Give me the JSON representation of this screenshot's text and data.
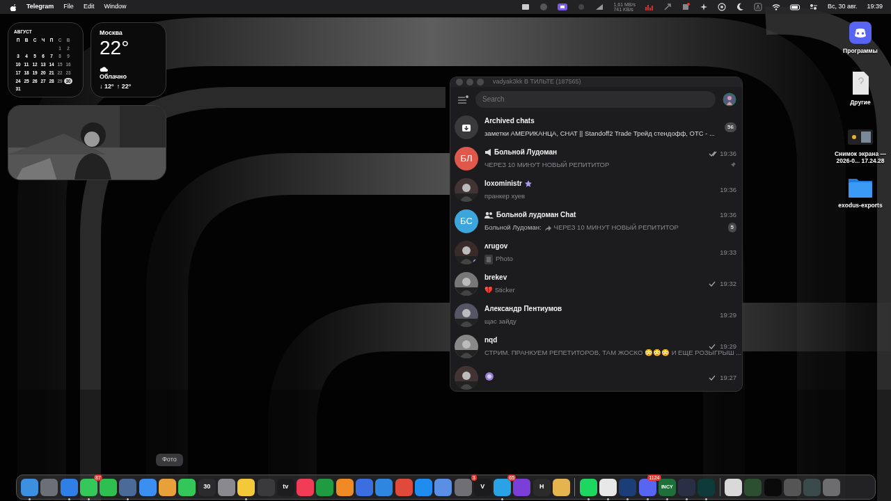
{
  "menu_bar": {
    "app": "Telegram",
    "menus": [
      "File",
      "Edit",
      "Window"
    ],
    "net_up": "1,61 MB/s",
    "net_down": "741 KB/s",
    "date": "Вс, 30 авг.",
    "time": "19:39"
  },
  "calendar_widget": {
    "month": "АВГУСТ",
    "weekdays": [
      "П",
      "В",
      "С",
      "Ч",
      "П",
      "С",
      "В"
    ],
    "weeks": [
      [
        {
          "day": "1",
          "selected": false
        },
        {
          "day": "2",
          "selected": false
        }
      ],
      [
        {
          "day": "3",
          "selected": false
        },
        {
          "day": "4",
          "selected": false
        },
        {
          "day": "5",
          "selected": false
        },
        {
          "day": "6",
          "selected": false
        },
        {
          "day": "7",
          "selected": false
        },
        {
          "day": "8",
          "selected": false
        },
        {
          "day": "9",
          "selected": false
        }
      ],
      [
        {
          "day": "10",
          "selected": false
        },
        {
          "day": "11",
          "selected": false
        },
        {
          "day": "12",
          "selected": false
        },
        {
          "day": "13",
          "selected": false
        },
        {
          "day": "14",
          "selected": false
        },
        {
          "day": "15",
          "selected": false
        },
        {
          "day": "16",
          "selected": false
        }
      ],
      [
        {
          "day": "17",
          "selected": false
        },
        {
          "day": "18",
          "selected": false
        },
        {
          "day": "19",
          "selected": false
        },
        {
          "day": "20",
          "selected": false
        },
        {
          "day": "21",
          "selected": false
        },
        {
          "day": "22",
          "selected": false
        },
        {
          "day": "23",
          "selected": false
        }
      ],
      [
        {
          "day": "24",
          "selected": false
        },
        {
          "day": "25",
          "selected": false
        },
        {
          "day": "26",
          "selected": false
        },
        {
          "day": "27",
          "selected": false
        },
        {
          "day": "28",
          "selected": false
        },
        {
          "day": "29",
          "selected": false
        },
        {
          "day": "30",
          "selected": true
        }
      ],
      [
        {
          "day": "31",
          "selected": false
        }
      ]
    ]
  },
  "weather_widget": {
    "city": "Москва",
    "temperature": "22°",
    "condition": "Облачно",
    "low": "↓ 12°",
    "high": "↑ 22°"
  },
  "photo_widget": {
    "kind": "picture"
  },
  "telegram_window": {
    "title": "vadyak3kk В ТИЛЬТЕ (187565)",
    "search": {
      "placeholder": "Search"
    },
    "chats": [
      {
        "kind": "archive",
        "name": "Archived chats",
        "preview": "заметки АМЕРИКАНЦА, CHAT || Standoff2 Trade Трейд стендофф, OTC - ...",
        "badge": "56"
      },
      {
        "kind": "channel",
        "initials": "БЛ",
        "color": "#e0584c",
        "name": "Больной Лудоман",
        "sent": true,
        "read": true,
        "time": "19:36",
        "preview": "ЧЕРЕЗ 10 МИНУТ НОВЫЙ РЕПИТИТОР",
        "pinned": true
      },
      {
        "kind": "user",
        "name": "loxoministr",
        "premium": true,
        "time": "19:36",
        "preview": "пранкер хуев"
      },
      {
        "kind": "group",
        "initials": "БС",
        "color": "#3ca5db",
        "name": "Больной лудоман Chat",
        "time": "19:36",
        "sender": "Больной Лудоман:",
        "forwarded": true,
        "preview": "ЧЕРЕЗ 10 МИНУТ НОВЫЙ РЕПИТИТОР",
        "badge": "5"
      },
      {
        "kind": "user",
        "name": "ʌruɡov",
        "online": true,
        "time": "19:33",
        "media_thumbnail": true,
        "preview": "Photo"
      },
      {
        "kind": "user",
        "name": "brekev",
        "sent": true,
        "read": false,
        "time": "19:32",
        "preview": "💔 Sticker"
      },
      {
        "kind": "user",
        "name": "Александр Пентиумов",
        "time": "19:29",
        "preview": "щас зайду"
      },
      {
        "kind": "user",
        "name": "nqd",
        "sent": true,
        "read": false,
        "time": "19:29",
        "preview": "СТРИМ. ПРАНКУЕМ РЕПЕТИТОРОВ, ТАМ ЖОСКО 😳😳😳 И ЕЩЕ РОЗЫГРЫШ ..."
      },
      {
        "kind": "user",
        "sticker_name": true,
        "sent": true,
        "read": false,
        "time": "19:27"
      }
    ]
  },
  "desktop_icons": [
    {
      "kind": "app",
      "label": "Программы"
    },
    {
      "kind": "document",
      "label": "Другие"
    },
    {
      "kind": "screenshot",
      "label": "Снимок экрана —\n2026-0... 17.24.28"
    },
    {
      "kind": "folder",
      "label": "exodus-exports"
    }
  ],
  "dock_tooltip": "Фото",
  "dock": [
    [
      {
        "color": "#3d8fe0",
        "running": true
      },
      {
        "color": "#6b6f78"
      },
      {
        "color": "#2f7fe6",
        "running": true
      },
      {
        "color": "#34c759",
        "badge": "87",
        "running": true
      },
      {
        "color": "#2fbf4f"
      },
      {
        "color": "#4c6a98",
        "running": true
      },
      {
        "color": "#3b8ff0"
      },
      {
        "color": "#e8a13a"
      },
      {
        "color": "#33c759"
      },
      {
        "color": "#2b2b2e",
        "label": "30"
      },
      {
        "color": "#8a8a8e"
      },
      {
        "color": "#f5c83a",
        "running": true
      },
      {
        "color": "#3a3a3c"
      },
      {
        "color": "#1d1d1f",
        "label": "tv"
      },
      {
        "color": "#f23b57"
      },
      {
        "color": "#1f9b41"
      },
      {
        "color": "#f08a24"
      },
      {
        "color": "#3b6ee0"
      },
      {
        "color": "#2f86e0"
      },
      {
        "color": "#e04a3a"
      },
      {
        "color": "#1f8cf0"
      },
      {
        "color": "#5b8fe6"
      },
      {
        "color": "#707074",
        "badge": "3"
      },
      {
        "color": "#1b1b1d",
        "label": "V"
      },
      {
        "color": "#2aa3e6",
        "badge": "65",
        "running": true
      },
      {
        "color": "#7b3fd8"
      },
      {
        "color": "#2b2b2b",
        "label": "H"
      },
      {
        "color": "#e3b450"
      }
    ],
    [
      {
        "color": "#1ed760",
        "running": true
      },
      {
        "color": "#e8e8e8",
        "running": true
      },
      {
        "color": "#1b3e78",
        "running": true
      },
      {
        "color": "#5865f2",
        "badge": "1124",
        "running": true
      },
      {
        "color": "#1f6f3a",
        "label": "INCY",
        "running": true
      },
      {
        "color": "#2b2f45",
        "running": true
      },
      {
        "color": "#0f3a3a",
        "running": true
      }
    ],
    [
      {
        "color": "#d9d9d9"
      },
      {
        "color": "#2b4f30"
      },
      {
        "color": "#0a0a0a"
      },
      {
        "color": "#555555"
      },
      {
        "color": "#3a4a4a"
      },
      {
        "color": "#6d6d70"
      }
    ]
  ]
}
